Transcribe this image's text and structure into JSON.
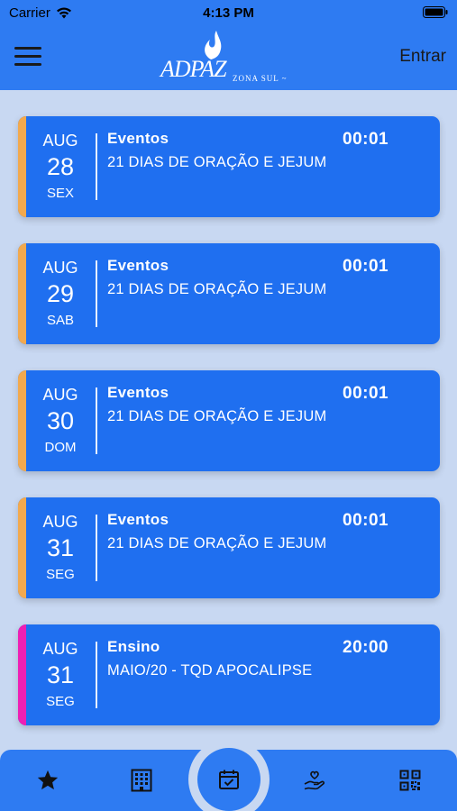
{
  "status_bar": {
    "carrier": "Carrier",
    "time": "4:13 PM"
  },
  "header": {
    "logo_main": "ADPAZ",
    "logo_sub": "ZONA SUL ~",
    "login_label": "Entrar"
  },
  "events": [
    {
      "month": "AUG",
      "day": "28",
      "weekday": "SEX",
      "category": "Eventos",
      "time": "00:01",
      "title": "21 DIAS DE ORAÇÃO E JEJUM",
      "accent": "#f2a94e"
    },
    {
      "month": "AUG",
      "day": "29",
      "weekday": "SAB",
      "category": "Eventos",
      "time": "00:01",
      "title": "21 DIAS DE ORAÇÃO E JEJUM",
      "accent": "#f2a94e"
    },
    {
      "month": "AUG",
      "day": "30",
      "weekday": "DOM",
      "category": "Eventos",
      "time": "00:01",
      "title": "21 DIAS DE ORAÇÃO E JEJUM",
      "accent": "#f2a94e"
    },
    {
      "month": "AUG",
      "day": "31",
      "weekday": "SEG",
      "category": "Eventos",
      "time": "00:01",
      "title": "21 DIAS DE ORAÇÃO E JEJUM",
      "accent": "#f2a94e"
    },
    {
      "month": "AUG",
      "day": "31",
      "weekday": "SEG",
      "category": "Ensino",
      "time": "20:00",
      "title": "MAIO/20 - TQD APOCALIPSE",
      "accent": "#ee1fb4"
    }
  ],
  "tabbar": {
    "tabs": [
      "star-icon",
      "building-icon",
      "calendar-check-icon",
      "hand-heart-icon",
      "qr-code-icon"
    ],
    "active_tab": "calendar-check-icon"
  },
  "colors": {
    "primary": "#2e7bf2",
    "card": "#1f6ff0",
    "background": "#c8d8f2"
  }
}
